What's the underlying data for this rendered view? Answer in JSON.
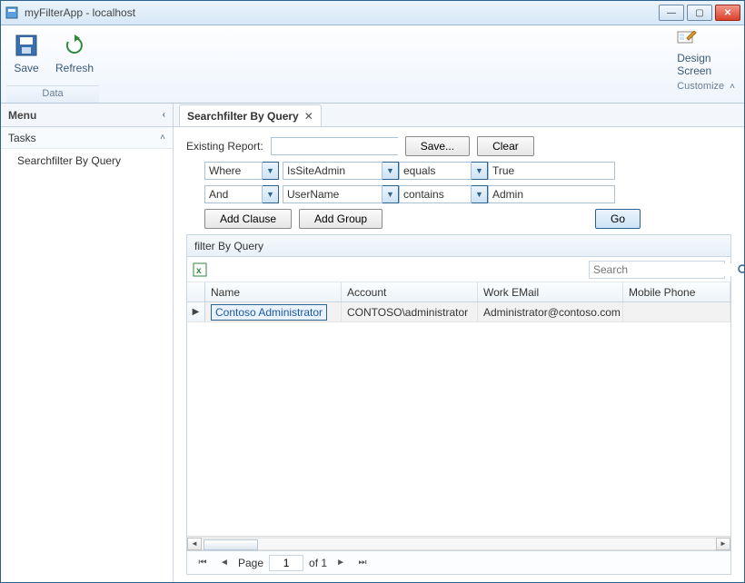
{
  "window": {
    "title": "myFilterApp - localhost"
  },
  "ribbon": {
    "save": "Save",
    "refresh": "Refresh",
    "data_group": "Data",
    "design": "Design",
    "screen": "Screen",
    "customize_group": "Customize"
  },
  "sidebar": {
    "menu": "Menu",
    "tasks": "Tasks",
    "item0": "Searchfilter By Query"
  },
  "tab": {
    "label": "Searchfilter By Query"
  },
  "report": {
    "label": "Existing Report:",
    "value": "",
    "save_btn": "Save...",
    "clear_btn": "Clear"
  },
  "filters": [
    {
      "op": "Where",
      "field": "IsSiteAdmin",
      "cmp": "equals",
      "val": "True"
    },
    {
      "op": "And",
      "field": "UserName",
      "cmp": "contains",
      "val": "Admin"
    }
  ],
  "filter_btns": {
    "add_clause": "Add Clause",
    "add_group": "Add Group",
    "go": "Go"
  },
  "grid": {
    "title": "filter By Query",
    "search_placeholder": "Search",
    "columns": [
      "Name",
      "Account",
      "Work EMail",
      "Mobile Phone"
    ],
    "rows": [
      {
        "name": "Contoso Administrator",
        "account": "CONTOSO\\administrator",
        "email": "Administrator@contoso.com",
        "phone": ""
      }
    ]
  },
  "pager": {
    "label_page": "Page",
    "current": "1",
    "of": "of 1"
  }
}
